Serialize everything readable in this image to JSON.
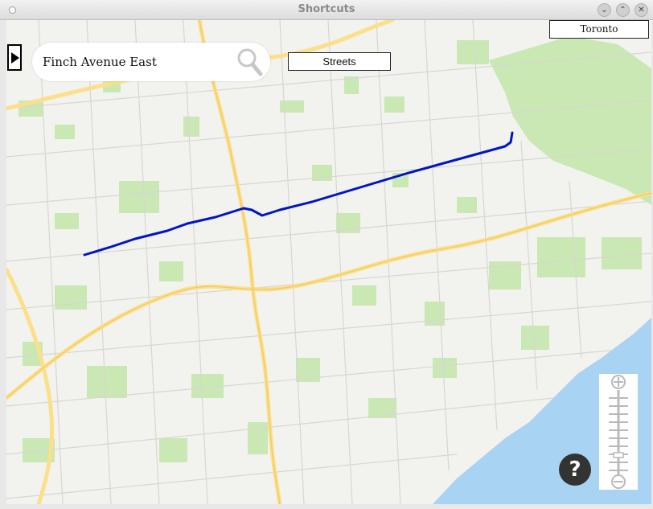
{
  "window": {
    "title": "Shortcuts",
    "controls": [
      "minimize",
      "maximize",
      "close"
    ]
  },
  "search": {
    "value": "Finch Avenue East",
    "icon": "magnifier-icon"
  },
  "toolbar": {
    "streets_label": "Streets",
    "city_label": "Toronto"
  },
  "map": {
    "highlighted_route": {
      "name": "Finch Avenue East",
      "color": "#0015c6"
    },
    "colors": {
      "background": "#f2f2ef",
      "parks": "#c9e8b4",
      "highways": "#fbe08a",
      "water": "#a9d3f2",
      "streets": "#d8d6d2"
    }
  },
  "zoom_control": {
    "zoom_in_icon": "zoom-in-icon",
    "zoom_out_icon": "zoom-out-icon",
    "level": 0.25
  },
  "help": {
    "label": "?"
  }
}
